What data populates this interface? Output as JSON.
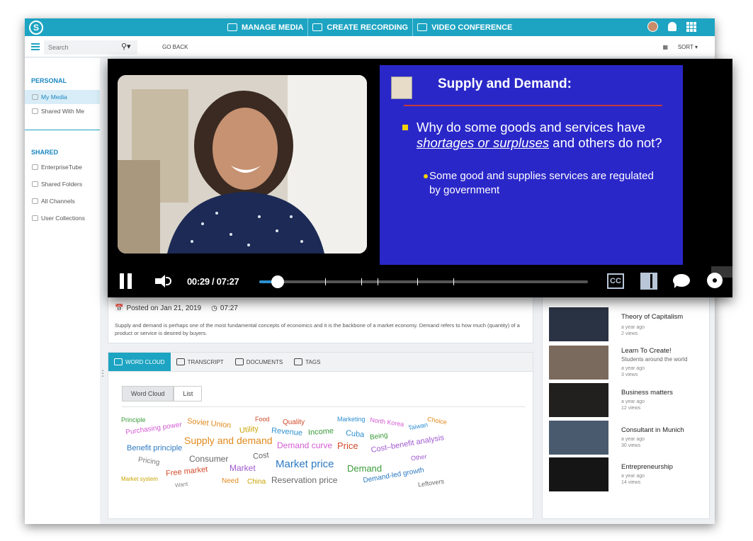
{
  "topbar": {
    "nav": [
      {
        "label": "MANAGE MEDIA",
        "icon": "media-icon"
      },
      {
        "label": "CREATE RECORDING",
        "icon": "recording-icon"
      },
      {
        "label": "VIDEO CONFERENCE",
        "icon": "conference-icon"
      }
    ]
  },
  "subbar": {
    "search_placeholder": "Search",
    "go_back": "GO BACK",
    "sort": "SORT"
  },
  "sidebar": {
    "personal_header": "PERSONAL",
    "personal_items": [
      "My Media",
      "Shared With Me"
    ],
    "shared_header": "SHARED",
    "shared_items": [
      "EnterpriseTube",
      "Shared Folders",
      "All Channels",
      "User Collections"
    ]
  },
  "video": {
    "time": "00:29 / 07:27",
    "progress": 0.055,
    "markers": [
      0.2,
      0.31,
      0.36,
      0.48,
      0.59
    ],
    "cc_label": "CC",
    "slide": {
      "title": "Supply and Demand:",
      "bullet1_pre": "Why do some goods and services have ",
      "bullet1_em": "shortages or surpluses",
      "bullet1_post": " and others do not?",
      "bullet2": "Some good and supplies services are regulated by government"
    }
  },
  "details": {
    "posted": "Posted on Jan 21, 2019",
    "duration": "07:27",
    "description": "Supply and demand is perhaps one of the most fundamental concepts of economics and it is the backbone of a market economy. Demand refers to how much (quantity) of a product or service is desired by buyers."
  },
  "tabs": [
    "WORD CLOUD",
    "TRANSCRIPT",
    "DOCUMENTS",
    "TAGS"
  ],
  "cloud_toggle": [
    "Word Cloud",
    "List"
  ],
  "word_cloud": [
    {
      "text": "Principle",
      "color": "#3a9a3a"
    },
    {
      "text": "Purchasing power",
      "color": "#d35bd3"
    },
    {
      "text": "Soviet Union",
      "color": "#e08a1c"
    },
    {
      "text": "Utility",
      "color": "#c9a400"
    },
    {
      "text": "Food",
      "color": "#d24a2a"
    },
    {
      "text": "Quality",
      "color": "#d24a2a"
    },
    {
      "text": "Revenue",
      "color": "#2d8fd0"
    },
    {
      "text": "Income",
      "color": "#3a9a3a"
    },
    {
      "text": "Marketing",
      "color": "#2d8fd0"
    },
    {
      "text": "Cuba",
      "color": "#2d8fd0"
    },
    {
      "text": "North Korea",
      "color": "#d35bd3"
    },
    {
      "text": "Taiwan",
      "color": "#2d8fd0"
    },
    {
      "text": "Choice",
      "color": "#e08a1c"
    },
    {
      "text": "Being",
      "color": "#3a9a3a"
    },
    {
      "text": "Supply and demand",
      "color": "#e08a1c"
    },
    {
      "text": "Benefit principle",
      "color": "#2d7ac2"
    },
    {
      "text": "Demand curve",
      "color": "#d35bd3"
    },
    {
      "text": "Price",
      "color": "#d24a2a"
    },
    {
      "text": "Cost–benefit analysis",
      "color": "#a05ad0"
    },
    {
      "text": "Consumer",
      "color": "#666666"
    },
    {
      "text": "Cost",
      "color": "#666666"
    },
    {
      "text": "Pricing",
      "color": "#777777"
    },
    {
      "text": "Market",
      "color": "#a05ad0"
    },
    {
      "text": "Market price",
      "color": "#2d7ac2"
    },
    {
      "text": "Demand",
      "color": "#3a9a3a"
    },
    {
      "text": "Other",
      "color": "#a05ad0"
    },
    {
      "text": "Free market",
      "color": "#d24a2a"
    },
    {
      "text": "Market system",
      "color": "#c9a400"
    },
    {
      "text": "Want",
      "color": "#888888"
    },
    {
      "text": "Need",
      "color": "#e08a1c"
    },
    {
      "text": "China",
      "color": "#c9a400"
    },
    {
      "text": "Reservation price",
      "color": "#666666"
    },
    {
      "text": "Demand-led growth",
      "color": "#2d7ac2"
    },
    {
      "text": "Leftovers",
      "color": "#666666"
    }
  ],
  "related": [
    {
      "title": "Theory of Capitalism",
      "subtitle": "",
      "age": "a year ago",
      "views": "2 views"
    },
    {
      "title": "Learn To Create!",
      "subtitle": "Students around the world",
      "age": "a year ago",
      "views": "3 views"
    },
    {
      "title": "Business matters",
      "subtitle": "",
      "age": "a year ago",
      "views": "12 views"
    },
    {
      "title": "Consultant in Munich",
      "subtitle": "",
      "age": "a year ago",
      "views": "30 views"
    },
    {
      "title": "Entrepreneurship",
      "subtitle": "",
      "age": "a year ago",
      "views": "14 views"
    }
  ]
}
